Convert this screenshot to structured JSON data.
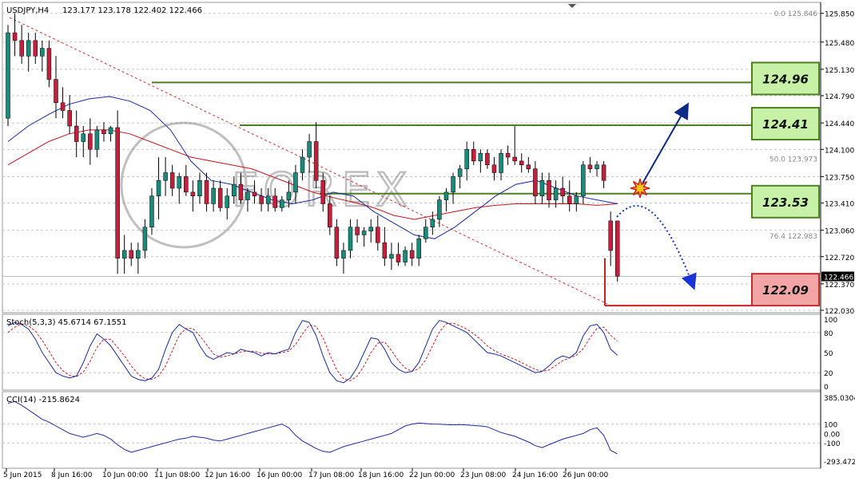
{
  "header": {
    "symbol_label": "USDJPY,H4",
    "ohlc_label": "123.177 123.178 122.402 122.466"
  },
  "colors": {
    "bull": "#1a8a7a",
    "bear": "#c2203c",
    "wick": "#000000",
    "ma_fast": "#1b2aa6",
    "ma_slow": "#c8141e",
    "trendline": "#e33030",
    "support_line": "#4e7f24",
    "target_line": "#cc1f1f",
    "green_box_fill": "#c6f1a6",
    "green_box_border": "#4e7f24",
    "red_box_fill": "#f3a5a5",
    "red_box_border": "#bf2f2f",
    "arrow_up": "#0c2a86",
    "arrow_down": "#1a33d6",
    "stoch_main": "#1b2aa6",
    "stoch_signal": "#d41f2a",
    "cci": "#1b2aa6",
    "price_badge_bg": "#000000",
    "price_badge_fg": "#ffffff"
  },
  "watermark_text": "FOREX",
  "fib_labels": [
    "0.0  125.846",
    "50.0  123.973",
    "76.4  122.983"
  ],
  "price_axis": {
    "ticks": [
      "125.850",
      "125.480",
      "125.130",
      "124.790",
      "124.440",
      "124.100",
      "123.750",
      "123.410",
      "123.060",
      "122.720",
      "122.370",
      "122.030"
    ],
    "current_price": "122.466"
  },
  "level_boxes": [
    {
      "label": "124.96",
      "kind": "resistance"
    },
    {
      "label": "124.41",
      "kind": "resistance"
    },
    {
      "label": "123.53",
      "kind": "pivot"
    },
    {
      "label": "122.09",
      "kind": "target"
    }
  ],
  "stochastic": {
    "label": "Stoch(5,3,3) 45.6714 67.1551",
    "ticks": [
      "100",
      "80",
      "50",
      "20",
      "0"
    ]
  },
  "cci": {
    "label": "CCI(14) -215.8624",
    "ticks": [
      "385.0304",
      "100",
      "0.00",
      "-100",
      "-293.4725"
    ]
  },
  "time_axis": {
    "labels": [
      "5 Jun 2015",
      "8 Jun 16:00",
      "10 Jun 00:00",
      "11 Jun 08:00",
      "12 Jun 16:00",
      "16 Jun 00:00",
      "17 Jun 08:00",
      "18 Jun 16:00",
      "22 Jun 00:00",
      "23 Jun 08:00",
      "24 Jun 16:00",
      "26 Jun 00:00"
    ]
  },
  "chart_data": {
    "type": "candlestick",
    "symbol": "USDJPY",
    "timeframe": "H4",
    "ylim": [
      122.03,
      125.97
    ],
    "levels": {
      "resistance": [
        124.96,
        124.41
      ],
      "pivot": 123.53,
      "target": 122.09,
      "fib": [
        {
          "ratio": 0.0,
          "price": 125.846
        },
        {
          "ratio": 50.0,
          "price": 123.973
        },
        {
          "ratio": 76.4,
          "price": 122.983
        }
      ]
    },
    "candles": [
      [
        124.5,
        125.7,
        124.4,
        125.6
      ],
      [
        125.6,
        125.85,
        125.3,
        125.5
      ],
      [
        125.5,
        125.7,
        125.2,
        125.3
      ],
      [
        125.3,
        125.6,
        125.1,
        125.5
      ],
      [
        125.5,
        125.6,
        125.2,
        125.3
      ],
      [
        125.3,
        125.5,
        125.1,
        125.4
      ],
      [
        125.4,
        125.5,
        124.9,
        125.0
      ],
      [
        125.0,
        125.3,
        124.5,
        124.7
      ],
      [
        124.7,
        124.9,
        124.5,
        124.6
      ],
      [
        124.6,
        124.8,
        124.3,
        124.4
      ],
      [
        124.4,
        124.6,
        124.0,
        124.2
      ],
      [
        124.2,
        124.4,
        124.0,
        124.3
      ],
      [
        124.3,
        124.5,
        123.9,
        124.1
      ],
      [
        124.1,
        124.4,
        124.0,
        124.35
      ],
      [
        124.35,
        124.45,
        124.2,
        124.3
      ],
      [
        124.3,
        124.4,
        124.2,
        124.38
      ],
      [
        124.38,
        124.6,
        122.5,
        122.7
      ],
      [
        122.7,
        123.0,
        122.5,
        122.8
      ],
      [
        122.8,
        122.9,
        122.6,
        122.7
      ],
      [
        122.7,
        122.9,
        122.5,
        122.8
      ],
      [
        122.8,
        123.2,
        122.7,
        123.1
      ],
      [
        123.1,
        123.6,
        123.0,
        123.5
      ],
      [
        123.5,
        124.0,
        123.2,
        123.7
      ],
      [
        123.7,
        124.0,
        123.5,
        123.8
      ],
      [
        123.8,
        123.9,
        123.5,
        123.6
      ],
      [
        123.6,
        123.8,
        123.4,
        123.75
      ],
      [
        123.75,
        123.9,
        123.5,
        123.55
      ],
      [
        123.55,
        123.7,
        123.3,
        123.5
      ],
      [
        123.5,
        123.8,
        123.4,
        123.7
      ],
      [
        123.7,
        123.8,
        123.3,
        123.4
      ],
      [
        123.4,
        123.7,
        123.3,
        123.6
      ],
      [
        123.6,
        123.7,
        123.3,
        123.35
      ],
      [
        123.35,
        123.6,
        123.2,
        123.5
      ],
      [
        123.5,
        123.75,
        123.4,
        123.65
      ],
      [
        123.65,
        123.8,
        123.4,
        123.45
      ],
      [
        123.45,
        123.6,
        123.3,
        123.55
      ],
      [
        123.55,
        123.7,
        123.4,
        123.5
      ],
      [
        123.5,
        123.6,
        123.3,
        123.4
      ],
      [
        123.4,
        123.6,
        123.3,
        123.5
      ],
      [
        123.5,
        123.6,
        123.3,
        123.35
      ],
      [
        123.35,
        123.5,
        123.3,
        123.45
      ],
      [
        123.45,
        123.7,
        123.35,
        123.55
      ],
      [
        123.55,
        123.9,
        123.4,
        123.8
      ],
      [
        123.8,
        124.1,
        123.7,
        124.0
      ],
      [
        124.0,
        124.3,
        123.8,
        124.2
      ],
      [
        124.2,
        124.45,
        123.6,
        123.7
      ],
      [
        123.7,
        123.8,
        123.3,
        123.4
      ],
      [
        123.4,
        123.5,
        123.0,
        123.1
      ],
      [
        123.1,
        123.2,
        122.6,
        122.7
      ],
      [
        122.7,
        122.9,
        122.5,
        122.8
      ],
      [
        122.8,
        123.2,
        122.7,
        123.1
      ],
      [
        123.1,
        123.2,
        122.9,
        123.0
      ],
      [
        123.0,
        123.1,
        122.85,
        123.05
      ],
      [
        123.05,
        123.2,
        122.9,
        123.1
      ],
      [
        123.1,
        123.25,
        122.8,
        122.9
      ],
      [
        122.9,
        123.1,
        122.6,
        122.7
      ],
      [
        122.7,
        122.9,
        122.55,
        122.75
      ],
      [
        122.75,
        122.9,
        122.6,
        122.65
      ],
      [
        122.65,
        122.85,
        122.6,
        122.8
      ],
      [
        122.8,
        122.9,
        122.6,
        122.7
      ],
      [
        122.7,
        123.0,
        122.6,
        122.95
      ],
      [
        122.95,
        123.2,
        122.9,
        123.1
      ],
      [
        123.1,
        123.3,
        123.0,
        123.2
      ],
      [
        123.2,
        123.5,
        123.1,
        123.45
      ],
      [
        123.45,
        123.6,
        123.3,
        123.55
      ],
      [
        123.55,
        123.8,
        123.4,
        123.75
      ],
      [
        123.75,
        123.9,
        123.6,
        123.85
      ],
      [
        123.85,
        124.2,
        123.7,
        124.1
      ],
      [
        124.1,
        124.2,
        123.9,
        123.95
      ],
      [
        123.95,
        124.1,
        123.8,
        124.05
      ],
      [
        124.05,
        124.1,
        123.85,
        123.9
      ],
      [
        123.9,
        124.0,
        123.7,
        123.8
      ],
      [
        123.8,
        124.1,
        123.7,
        124.05
      ],
      [
        124.05,
        124.15,
        123.9,
        124.0
      ],
      [
        124.0,
        124.4,
        123.9,
        123.95
      ],
      [
        123.95,
        124.05,
        123.8,
        123.9
      ],
      [
        123.9,
        124.0,
        123.8,
        123.85
      ],
      [
        123.85,
        123.95,
        123.4,
        123.5
      ],
      [
        123.5,
        123.8,
        123.4,
        123.7
      ],
      [
        123.7,
        123.8,
        123.35,
        123.45
      ],
      [
        123.45,
        123.7,
        123.35,
        123.6
      ],
      [
        123.6,
        123.75,
        123.4,
        123.5
      ],
      [
        123.5,
        123.7,
        123.3,
        123.4
      ],
      [
        123.4,
        123.55,
        123.3,
        123.5
      ],
      [
        123.5,
        123.95,
        123.4,
        123.9
      ],
      [
        123.9,
        124.0,
        123.8,
        123.85
      ],
      [
        123.85,
        123.95,
        123.75,
        123.9
      ],
      [
        123.9,
        123.95,
        123.6,
        123.7
      ],
      [
        123.18,
        123.3,
        122.6,
        122.8
      ],
      [
        123.18,
        123.18,
        122.4,
        122.47
      ]
    ],
    "indicators": {
      "ma_fast_y": [
        124.2,
        124.4,
        124.55,
        124.68,
        124.75,
        124.78,
        124.72,
        124.6,
        124.35,
        123.95,
        123.7,
        123.65,
        123.55,
        123.45,
        123.4,
        123.45,
        123.55,
        123.5,
        123.3,
        123.15,
        123.0,
        122.95,
        123.1,
        123.3,
        123.5,
        123.65,
        123.7,
        123.6,
        123.5,
        123.45,
        123.4
      ],
      "ma_slow_y": [
        123.9,
        124.05,
        124.2,
        124.3,
        124.35,
        124.35,
        124.3,
        124.2,
        124.1,
        124.0,
        123.95,
        123.9,
        123.85,
        123.75,
        123.65,
        123.55,
        123.48,
        123.42,
        123.35,
        123.25,
        123.2,
        123.25,
        123.3,
        123.35,
        123.38,
        123.4,
        123.4,
        123.4,
        123.4,
        123.38,
        123.4
      ],
      "stochastic_main": [
        90,
        95,
        92,
        85,
        70,
        50,
        35,
        20,
        15,
        12,
        15,
        35,
        60,
        78,
        70,
        60,
        45,
        30,
        15,
        10,
        8,
        12,
        25,
        55,
        80,
        92,
        85,
        80,
        60,
        45,
        40,
        45,
        50,
        48,
        55,
        52,
        50,
        45,
        50,
        48,
        52,
        55,
        80,
        98,
        95,
        75,
        45,
        20,
        8,
        5,
        12,
        28,
        50,
        72,
        70,
        55,
        35,
        25,
        20,
        22,
        35,
        60,
        85,
        98,
        95,
        90,
        85,
        80,
        70,
        60,
        50,
        48,
        45,
        40,
        35,
        30,
        25,
        20,
        22,
        30,
        40,
        45,
        42,
        50,
        75,
        90,
        92,
        80,
        55,
        46
      ],
      "stochastic_signal": [
        80,
        88,
        93,
        90,
        82,
        68,
        52,
        35,
        23,
        16,
        14,
        21,
        37,
        58,
        70,
        70,
        58,
        45,
        30,
        18,
        11,
        10,
        15,
        30,
        53,
        76,
        86,
        86,
        75,
        62,
        48,
        43,
        45,
        48,
        51,
        52,
        52,
        49,
        48,
        48,
        50,
        52,
        62,
        78,
        91,
        89,
        72,
        47,
        24,
        11,
        8,
        15,
        30,
        50,
        64,
        66,
        53,
        38,
        27,
        22,
        26,
        39,
        60,
        81,
        93,
        94,
        90,
        85,
        78,
        70,
        60,
        53,
        48,
        44,
        40,
        35,
        30,
        25,
        22,
        24,
        31,
        38,
        42,
        46,
        56,
        72,
        86,
        88,
        76,
        67
      ],
      "cci": [
        320,
        340,
        300,
        250,
        200,
        150,
        120,
        80,
        40,
        0,
        -20,
        -40,
        -20,
        0,
        -20,
        -60,
        -120,
        -170,
        -200,
        -180,
        -160,
        -140,
        -120,
        -100,
        -80,
        -60,
        -50,
        -30,
        -40,
        -50,
        -70,
        -80,
        -60,
        -40,
        -20,
        0,
        20,
        40,
        60,
        80,
        100,
        60,
        -20,
        -80,
        -120,
        -160,
        -190,
        -200,
        -170,
        -140,
        -120,
        -100,
        -80,
        -60,
        -40,
        -20,
        0,
        40,
        80,
        100,
        110,
        105,
        100,
        98,
        95,
        92,
        95,
        90,
        85,
        80,
        70,
        40,
        10,
        -10,
        -30,
        -60,
        -90,
        -130,
        -150,
        -120,
        -90,
        -60,
        -40,
        -20,
        0,
        40,
        60,
        -20,
        -180,
        -216
      ]
    }
  }
}
